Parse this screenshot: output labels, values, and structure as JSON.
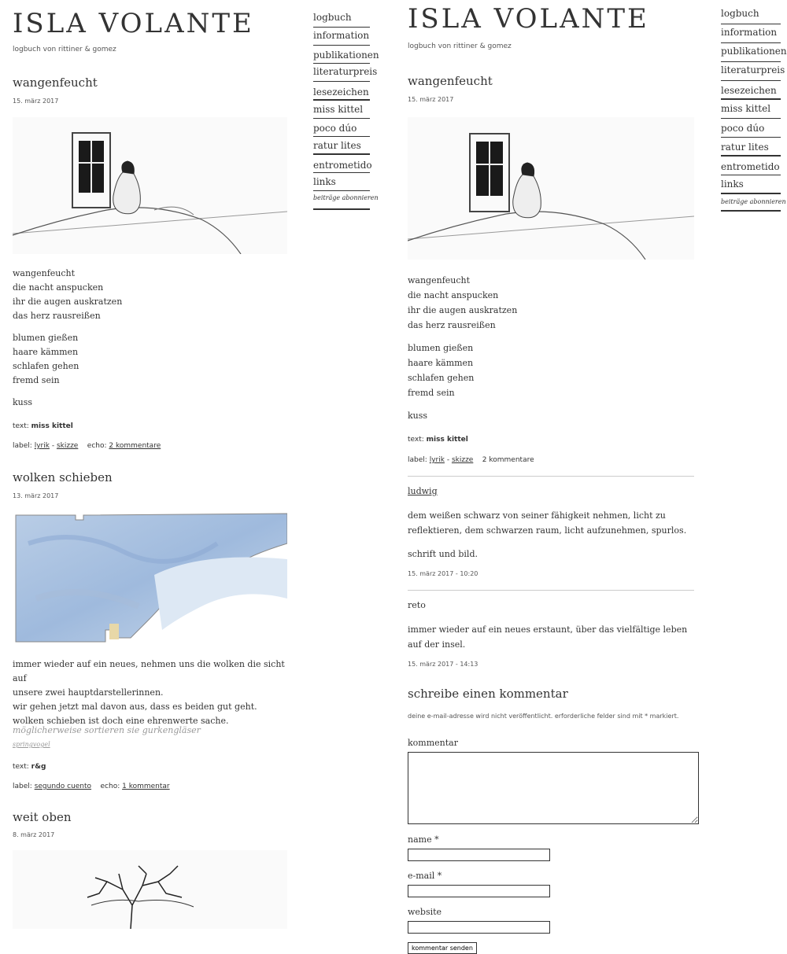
{
  "left": {
    "site_title": "ISLA VOLANTE",
    "tagline": "logbuch von rittiner & gomez",
    "nav": [
      "logbuch",
      "information",
      "publikationen",
      "literaturpreis",
      "lesezeichen",
      "miss kittel",
      "poco dúo",
      "ratur lites",
      "entrometido",
      "links"
    ],
    "nav_subscribe": "beiträge abonnieren",
    "post1": {
      "title": "wangenfeucht",
      "date": "15. märz 2017",
      "stanza1": [
        "wangenfeucht",
        "die nacht anspucken",
        "ihr die augen auskratzen",
        "das herz rausreißen"
      ],
      "stanza2": [
        "blumen gießen",
        "haare kämmen",
        "schlafen gehen",
        "fremd sein"
      ],
      "stanza3": "kuss",
      "text_label": "text:",
      "text_author": "miss kittel",
      "label_prefix": "label:",
      "label1": "lyrik",
      "label_sep": "-",
      "label2": "skizze",
      "echo_prefix": "echo:",
      "echo_link": "2 kommentare"
    },
    "post2": {
      "title": "wolken schieben",
      "date": "13. märz 2017",
      "body": [
        "immer wieder auf ein neues, nehmen uns die wolken die sicht auf",
        "unsere zwei hauptdarstellerinnen.",
        "wir gehen jetzt mal davon aus, dass es beiden gut geht.",
        "wolken schieben ist doch eine ehrenwerte sache."
      ],
      "quote": "möglicherweise sortieren sie gurkengläser",
      "quote_link": "springvogel",
      "text_label": "text:",
      "text_author": "r&g",
      "label_prefix": "label:",
      "label1": "segundo cuento",
      "echo_prefix": "echo:",
      "echo_link": "1 kommentar"
    },
    "post3": {
      "title": "weit oben",
      "date": "8. märz 2017"
    }
  },
  "right": {
    "site_title": "ISLA VOLANTE",
    "tagline": "logbuch von rittiner & gomez",
    "nav": [
      "logbuch",
      "information",
      "publikationen",
      "literaturpreis",
      "lesezeichen",
      "miss kittel",
      "poco dúo",
      "ratur lites",
      "entrometido",
      "links"
    ],
    "nav_subscribe": "beiträge abonnieren",
    "post": {
      "title": "wangenfeucht",
      "date": "15. märz 2017",
      "stanza1": [
        "wangenfeucht",
        "die nacht anspucken",
        "ihr die augen auskratzen",
        "das herz rausreißen"
      ],
      "stanza2": [
        "blumen gießen",
        "haare kämmen",
        "schlafen gehen",
        "fremd sein"
      ],
      "stanza3": "kuss",
      "text_label": "text:",
      "text_author": "miss kittel",
      "label_prefix": "label:",
      "label1": "lyrik",
      "label_sep": "-",
      "label2": "skizze",
      "comments_count": "2 kommentare"
    },
    "comments": [
      {
        "author": "ludwig",
        "paragraphs": [
          "dem weißen schwarz von seiner fähigkeit nehmen, licht zu reflektieren, dem schwarzen raum, licht aufzunehmen, spurlos.",
          "schrift und bild."
        ],
        "date": "15. märz 2017 - 10:20"
      },
      {
        "author": "reto",
        "paragraphs": [
          "immer wieder auf ein neues erstaunt, über das vielfältige leben auf der insel."
        ],
        "date": "15. märz 2017 - 14:13"
      }
    ],
    "form": {
      "heading": "schreibe einen kommentar",
      "note": "deine e-mail-adresse wird nicht veröffentlicht. erforderliche felder sind mit * markiert.",
      "comment_label": "kommentar",
      "name_label": "name *",
      "email_label": "e-mail *",
      "website_label": "website",
      "submit_label": "kommentar senden"
    }
  }
}
